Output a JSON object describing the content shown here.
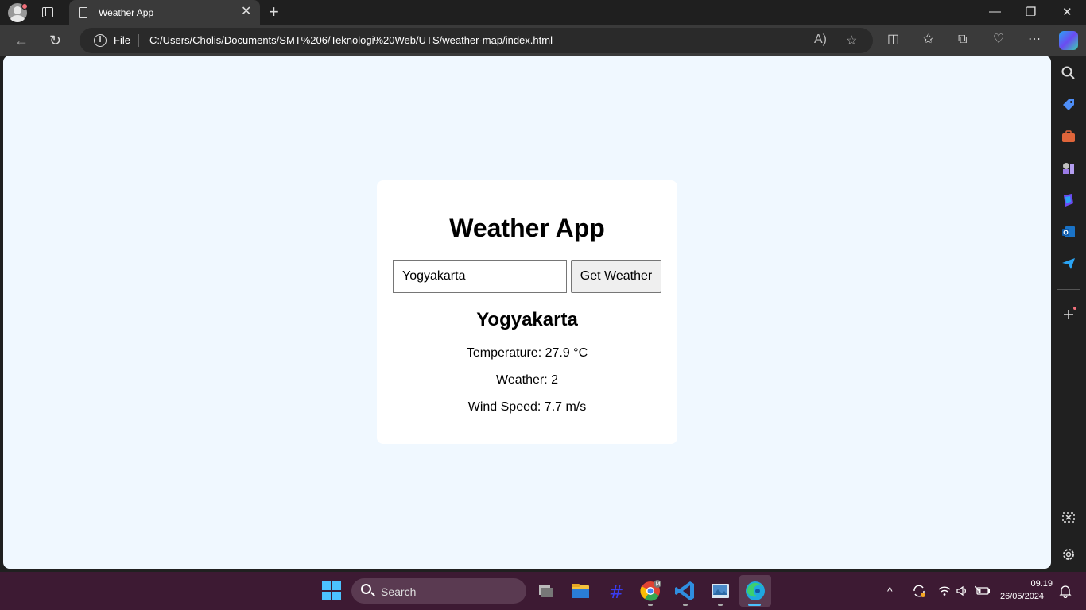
{
  "browser": {
    "tab_title": "Weather App",
    "file_label": "File",
    "url": "C:/Users/Cholis/Documents/SMT%206/Teknologi%20Web/UTS/weather-map/index.html"
  },
  "app": {
    "title": "Weather App",
    "input_value": "Yogyakarta",
    "button_label": "Get Weather",
    "city": "Yogyakarta",
    "temperature": "Temperature: 27.9 °C",
    "weather": "Weather: 2",
    "wind": "Wind Speed: 7.7 m/s"
  },
  "taskbar": {
    "search_label": "Search",
    "time": "09.19",
    "date": "26/05/2024"
  },
  "colors": {
    "page_background": "#f0f8ff",
    "card_background": "#ffffff",
    "taskbar": "#3d1a33"
  }
}
